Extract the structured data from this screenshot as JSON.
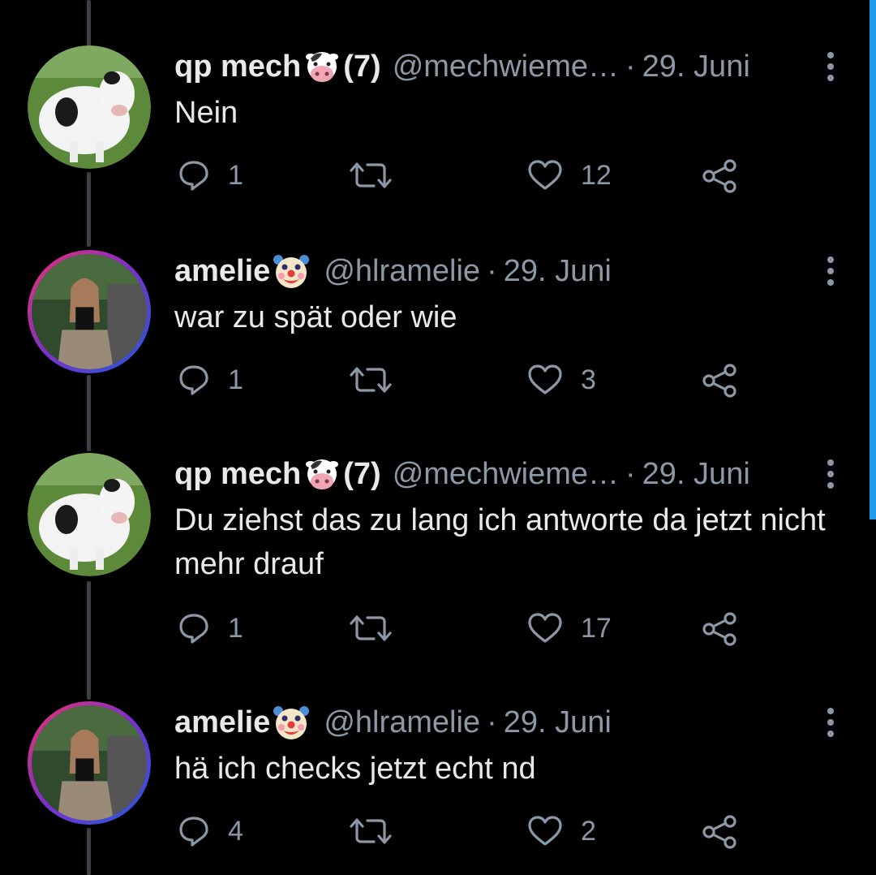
{
  "tweets": [
    {
      "name": "qp mech",
      "emoji": "cow-face-emoji",
      "count": "(7)",
      "handle": "@mechwieme…",
      "dot": "·",
      "date": "29. Juni",
      "text": "Nein",
      "replies": "1",
      "likes": "12",
      "avatar": "cow-photo"
    },
    {
      "name": "amelie",
      "emoji": "clown-face-emoji",
      "count": "",
      "handle": "@hlramelie",
      "dot": "·",
      "date": "29. Juni",
      "text": "war zu spät oder wie",
      "replies": "1",
      "likes": "3",
      "avatar": "person-photo"
    },
    {
      "name": "qp mech",
      "emoji": "cow-face-emoji",
      "count": "(7)",
      "handle": "@mechwieme…",
      "dot": "·",
      "date": "29. Juni",
      "text": "Du ziehst das zu lang ich antworte da jetzt nicht mehr drauf",
      "replies": "1",
      "likes": "17",
      "avatar": "cow-photo"
    },
    {
      "name": "amelie",
      "emoji": "clown-face-emoji",
      "count": "",
      "handle": "@hlramelie",
      "dot": "·",
      "date": "29. Juni",
      "text": "hä ich checks jetzt echt nd",
      "replies": "4",
      "likes": "2",
      "avatar": "person-photo"
    }
  ],
  "colors": {
    "background": "#000000",
    "text": "#e7e9ea",
    "muted": "#8b98a5",
    "thread_line": "#3b4045",
    "story_ring": [
      "#f0306c",
      "#7b2fd0",
      "#1e5dd6"
    ],
    "scroll_indicator": "#1d9bf0"
  }
}
